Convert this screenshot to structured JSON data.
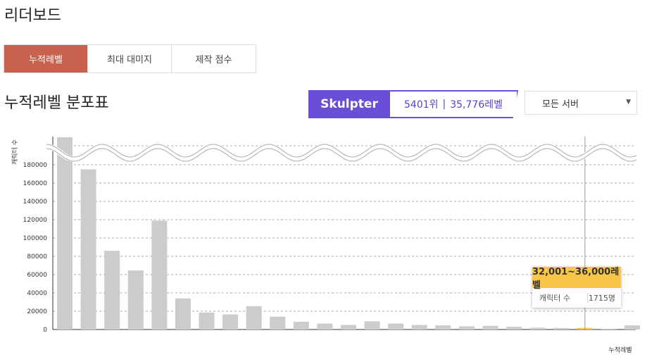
{
  "page_title": "리더보드",
  "tabs": [
    {
      "label": "누적레벨",
      "active": true
    },
    {
      "label": "최대 대미지",
      "active": false
    },
    {
      "label": "제작 점수",
      "active": false
    }
  ],
  "section_title": "누적레벨 분포표",
  "user": {
    "name": "Skulpter",
    "rank": "5401위",
    "divider": "|",
    "level": "35,776레벨"
  },
  "server_select": {
    "selected": "모든 서버"
  },
  "tooltip": {
    "range": "32,001~36,000레벨",
    "label": "캐릭터 수",
    "value": "1715명"
  },
  "colors": {
    "accent": "#c8624e",
    "purple": "#6a4fd6",
    "bar": "#cccccc",
    "highlight": "#f7c548"
  },
  "chart_data": {
    "type": "bar",
    "ylabel": "캐릭터 수",
    "xlabel": "누적레벨",
    "ylim": [
      0,
      210000
    ],
    "y_break": true,
    "yticks": [
      0,
      20000,
      40000,
      60000,
      80000,
      100000,
      120000,
      140000,
      160000,
      180000
    ],
    "grid": true,
    "values": [
      210000,
      175000,
      86000,
      64500,
      119000,
      34000,
      18500,
      16500,
      25500,
      14000,
      8500,
      6500,
      5000,
      9000,
      6500,
      5000,
      4500,
      3500,
      4000,
      3000,
      2000,
      1700,
      1715,
      700,
      4500
    ],
    "highlight_index": 22
  }
}
